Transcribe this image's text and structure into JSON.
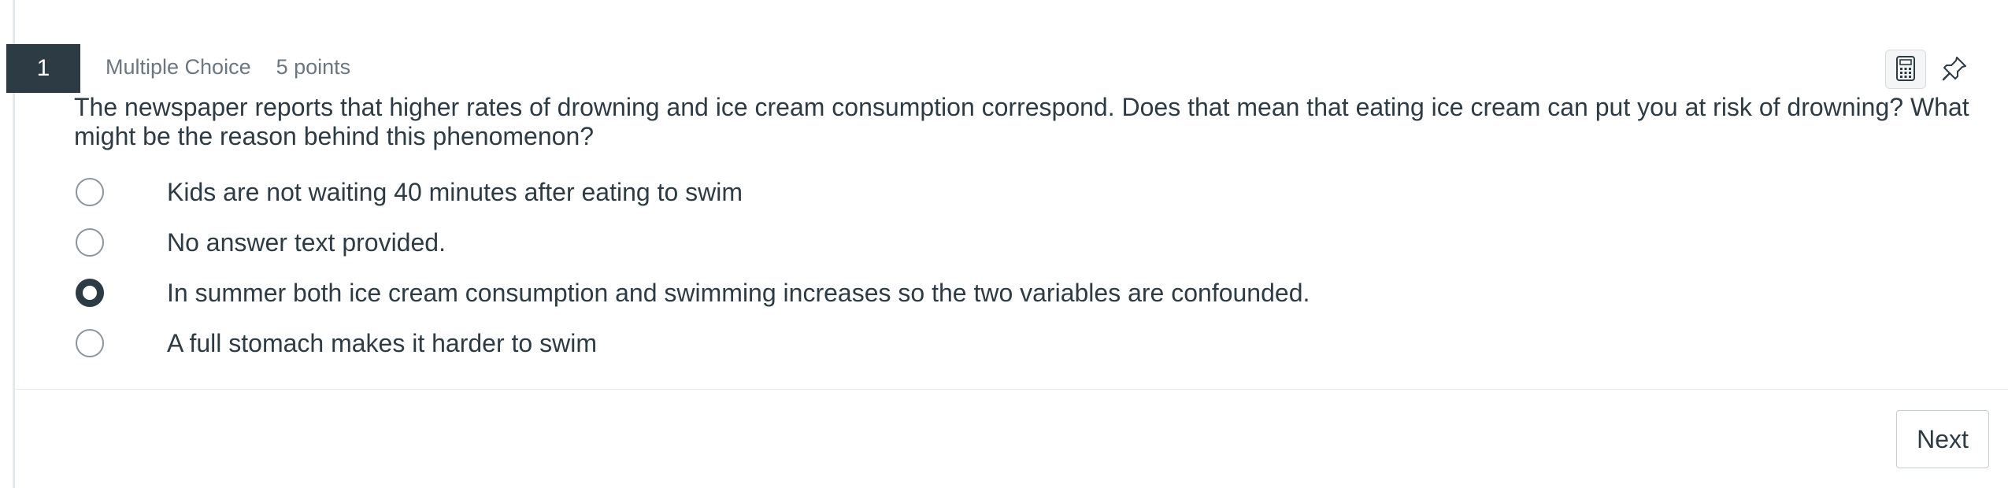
{
  "question": {
    "number": "1",
    "type": "Multiple Choice",
    "points": "5 points",
    "prompt": "The newspaper reports that higher rates of drowning and ice cream consumption correspond. Does that mean that eating ice cream can put you at risk of drowning? What might be the reason behind this phenomenon?",
    "options": [
      {
        "label": "Kids are not waiting 40 minutes after eating to swim",
        "selected": false
      },
      {
        "label": "No answer text provided.",
        "selected": false
      },
      {
        "label": "In summer both ice cream consumption and swimming increases so the two variables are confounded.",
        "selected": true
      },
      {
        "label": "A full stomach makes it harder to swim",
        "selected": false
      }
    ]
  },
  "tools": {
    "calculator_icon": "calculator-icon",
    "pin_icon": "pin-icon"
  },
  "footer": {
    "next_label": "Next"
  },
  "colors": {
    "text": "#2d3b45",
    "number_badge_bg": "#2d3b45",
    "meta_text": "#6b7780",
    "divider": "#e6e8ea",
    "radio_border": "#8b959c"
  }
}
